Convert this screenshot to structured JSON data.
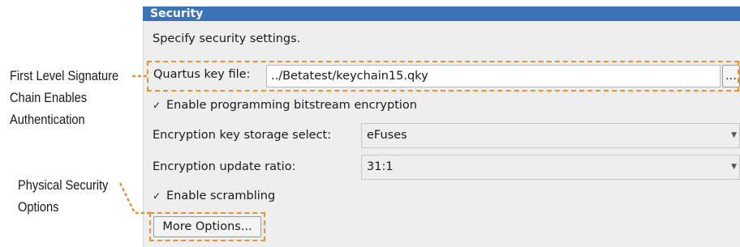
{
  "panel": {
    "title": "Security",
    "subtitle": "Specify security settings."
  },
  "key_file": {
    "label": "Quartus key file:",
    "value": "../Betatest/keychain15.qky",
    "browse_label": "..."
  },
  "encryption_checkbox": {
    "label": "Enable programming bitstream encryption",
    "checked": true,
    "mark": "✓"
  },
  "key_storage": {
    "label": "Encryption key storage select:",
    "value": "eFuses"
  },
  "update_ratio": {
    "label": "Encryption update ratio:",
    "value": "31:1"
  },
  "scrambling_checkbox": {
    "label": "Enable scrambling",
    "checked": true,
    "mark": "✓"
  },
  "more_options": {
    "label": "More Options..."
  },
  "callouts": {
    "first": [
      "First Level Signature",
      "Chain Enables",
      "Authentication"
    ],
    "second": [
      "Physical Security",
      "Options"
    ]
  },
  "colors": {
    "title_bar": "#3d73b7",
    "callout": "#e8903a",
    "panel": "#eeeeee"
  },
  "icons": {
    "dropdown": "chevron-down-icon",
    "check": "checkmark-icon"
  }
}
